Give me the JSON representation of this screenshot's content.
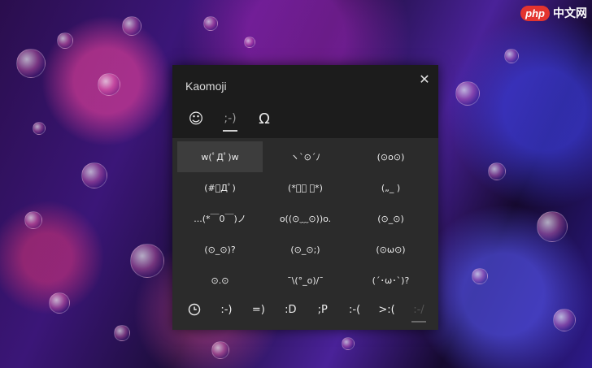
{
  "watermark": {
    "logo": "php",
    "text": "中文网"
  },
  "panel": {
    "title": "Kaomoji",
    "close_glyph": "✕",
    "category_tabs": [
      {
        "name": "emoji",
        "glyph": "☺"
      },
      {
        "name": "kaomoji",
        "glyph": ";-)"
      },
      {
        "name": "symbols",
        "glyph": "Ω"
      }
    ],
    "kaomoji": [
      "w(ﾟДﾟ)w",
      "ヽ`⊙´ﾉ",
      "(⊙o⊙)",
      "(#ﾟДﾟ)",
      "(*ﾟ￣ ﾟ*)",
      "(„_ )",
      "...(*￣0￣)ノ",
      "o((⊙﹏⊙))o.",
      "(⊙_⊙)",
      "(⊙_⊙)?",
      "(⊙_⊙;)",
      "(⊙ω⊙)",
      "⊙.⊙",
      "¯\\(°_o)/¯",
      "(´･ω･`)?"
    ],
    "bottom_items": [
      ":-)",
      "=)",
      ":D",
      ";P",
      ":-(",
      ">:(",
      ":-/"
    ]
  }
}
